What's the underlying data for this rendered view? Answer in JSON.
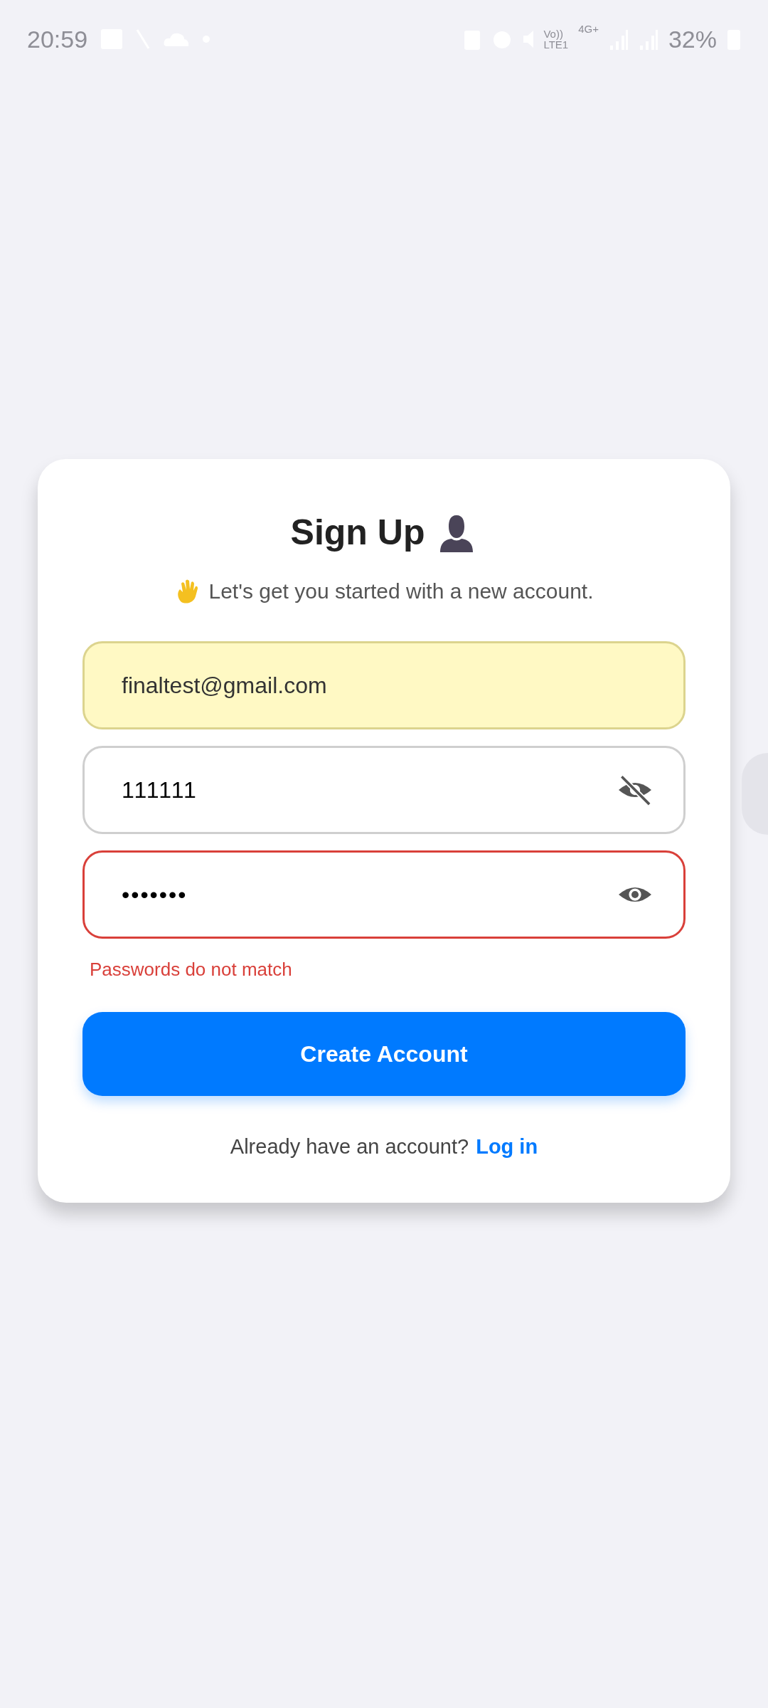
{
  "status_bar": {
    "time": "20:59",
    "volte": "Vo))",
    "lte": "LTE1",
    "network": "4G+",
    "battery": "32%"
  },
  "card": {
    "title": "Sign Up",
    "subtitle": "Let's get you started with a new account.",
    "fields": [
      {
        "kind": "email",
        "value": "finaltest@gmail.com",
        "autofilled": true,
        "error": false
      },
      {
        "kind": "password",
        "value": "111111",
        "masked": false,
        "autofilled": false,
        "error": false
      },
      {
        "kind": "password",
        "value": "•••••••",
        "masked": true,
        "autofilled": false,
        "error": true
      }
    ],
    "error_message": "Passwords do not match",
    "submit": "Create Account",
    "footer": {
      "text": "Already have an account?",
      "link": "Log in"
    }
  }
}
